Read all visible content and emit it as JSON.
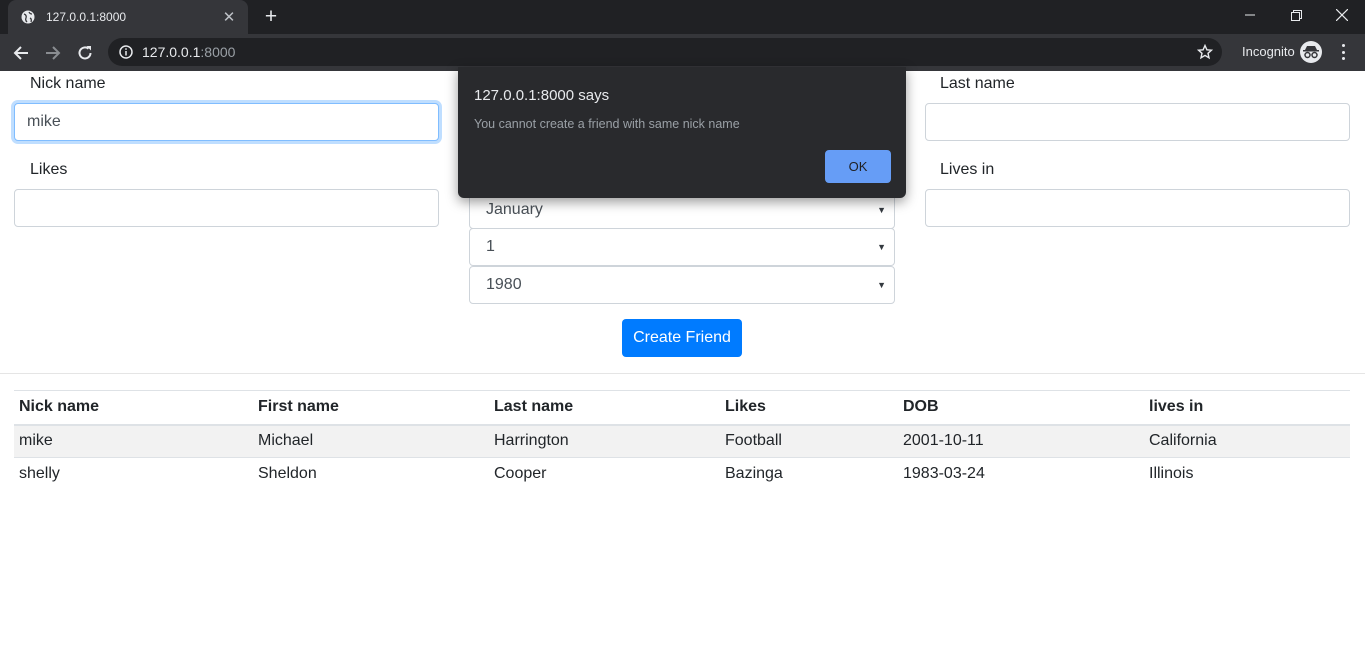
{
  "browser": {
    "tab_title": "127.0.0.1:8000",
    "new_tab": "+",
    "url_host": "127.0.0.1",
    "url_port": ":8000",
    "incognito_label": "Incognito"
  },
  "form": {
    "nick_name_label": "Nick name",
    "nick_name_value": "mike",
    "last_name_label": "Last name",
    "last_name_value": "",
    "likes_label": "Likes",
    "likes_value": "",
    "lives_in_label": "Lives in",
    "lives_in_value": "",
    "month_value": "January",
    "day_value": "1",
    "year_value": "1980",
    "create_button": "Create Friend"
  },
  "table": {
    "headers": [
      "Nick name",
      "First name",
      "Last name",
      "Likes",
      "DOB",
      "lives in"
    ],
    "rows": [
      [
        "mike",
        "Michael",
        "Harrington",
        "Football",
        "2001-10-11",
        "California"
      ],
      [
        "shelly",
        "Sheldon",
        "Cooper",
        "Bazinga",
        "1983-03-24",
        "Illinois"
      ]
    ]
  },
  "dialog": {
    "title": "127.0.0.1:8000 says",
    "message": "You cannot create a friend with same nick name",
    "ok_label": "OK"
  }
}
